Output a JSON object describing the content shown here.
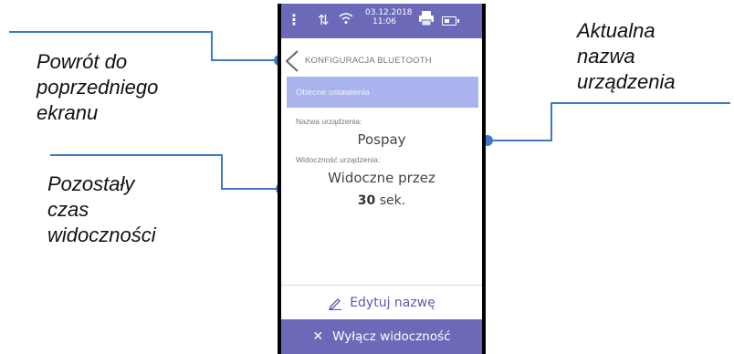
{
  "callouts": {
    "back": [
      "Powrót do",
      "poprzedniego",
      "ekranu"
    ],
    "remaining": [
      "Pozostały",
      "czas",
      "widoczności"
    ],
    "current_name": [
      "Aktualna",
      "nazwa",
      "urządzenia"
    ]
  },
  "status_bar": {
    "menu_icon": "vertical-dots-icon",
    "usb_icon": "usb-icon",
    "wifi_icon": "wifi-icon",
    "date": "03.12.2018",
    "time": "11:06",
    "printer_icon": "printer-icon",
    "battery_icon": "battery-icon"
  },
  "header": {
    "title": "KONFIGURACJA BLUETOOTH",
    "back_icon": "chevron-left-icon"
  },
  "section": {
    "title": "Obecne ustawienia"
  },
  "device": {
    "name_label": "Nazwa urządzenia:",
    "name_value": "Pospay",
    "visibility_label": "Widoczność urządzenia:",
    "visibility_text": "Widoczne przez",
    "visibility_seconds": "30",
    "visibility_unit": "sek."
  },
  "buttons": {
    "edit_label": "Edytuj nazwę",
    "disable_label": "Wyłącz widoczność"
  },
  "colors": {
    "accent": "#6c6ab8",
    "section_band": "#a9b4ee",
    "connector": "#3f78c8"
  }
}
